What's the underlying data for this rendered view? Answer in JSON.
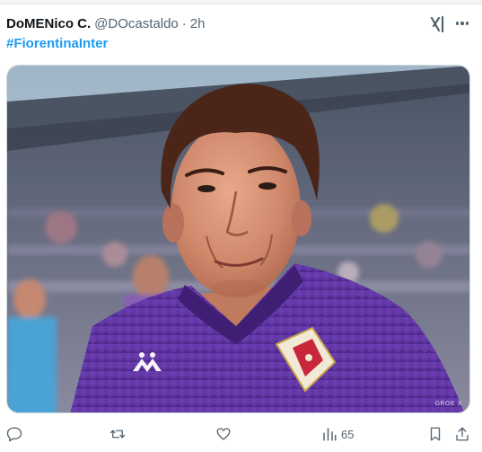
{
  "tweet": {
    "author": {
      "display_name": "DoMENico C.",
      "handle": "@DOcastaldo",
      "separator": "·",
      "time": "2h"
    },
    "hashtag": "#FiorentinaInter",
    "media": {
      "type": "photo",
      "watermark": "GROK X",
      "jersey_brand": "Kappa"
    },
    "actions": {
      "reply_icon": "reply-icon",
      "retweet_icon": "retweet-icon",
      "like_icon": "heart-icon",
      "views_icon": "views-chart-icon",
      "views_count": "65",
      "bookmark_icon": "bookmark-icon",
      "share_icon": "share-icon"
    }
  },
  "colors": {
    "link_blue": "#1d9bf0",
    "muted_text": "#536471",
    "jersey_purple": "#5a2d9a"
  }
}
